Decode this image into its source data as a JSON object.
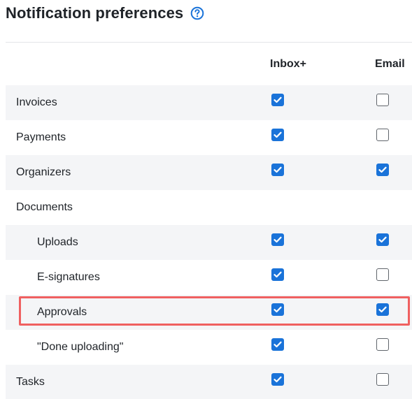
{
  "title": "Notification preferences",
  "columns": {
    "inbox": "Inbox+",
    "email": "Email"
  },
  "accent_color": "#1a73d9",
  "highlight_color": "#ef6060",
  "rows": [
    {
      "label": "Invoices",
      "indent": 0,
      "inbox": true,
      "email": false
    },
    {
      "label": "Payments",
      "indent": 0,
      "inbox": true,
      "email": false
    },
    {
      "label": "Organizers",
      "indent": 0,
      "inbox": true,
      "email": true
    },
    {
      "label": "Documents",
      "indent": 0,
      "inbox": null,
      "email": null
    },
    {
      "label": "Uploads",
      "indent": 1,
      "inbox": true,
      "email": true
    },
    {
      "label": "E-signatures",
      "indent": 1,
      "inbox": true,
      "email": false
    },
    {
      "label": "Approvals",
      "indent": 1,
      "inbox": true,
      "email": true,
      "highlighted": true
    },
    {
      "label": "\"Done uploading\"",
      "indent": 1,
      "inbox": true,
      "email": false
    },
    {
      "label": "Tasks",
      "indent": 0,
      "inbox": true,
      "email": false
    }
  ]
}
